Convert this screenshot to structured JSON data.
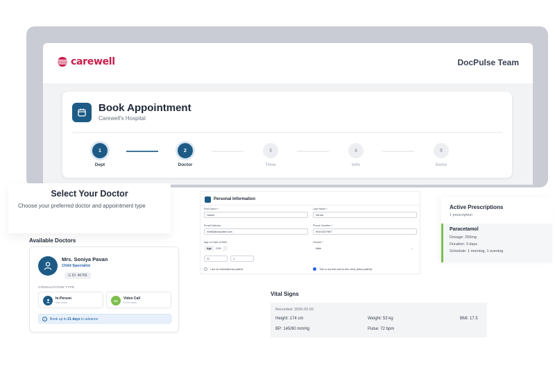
{
  "header": {
    "brand": "carewell",
    "team": "DocPulse Team"
  },
  "booking": {
    "title": "Book Appointment",
    "subtitle": "Carewell's Hospital",
    "steps": [
      {
        "num": "1",
        "label": "Dept",
        "state": "active"
      },
      {
        "num": "2",
        "label": "Doctor",
        "state": "active"
      },
      {
        "num": "3",
        "label": "Time",
        "state": "inactive"
      },
      {
        "num": "4",
        "label": "Info",
        "state": "inactive"
      },
      {
        "num": "5",
        "label": "Done",
        "state": "inactive"
      }
    ]
  },
  "select": {
    "title": "Select Your Doctor",
    "subtitle": "Choose your preferred doctor and appointment type"
  },
  "doctors": {
    "section_title": "Available Doctors",
    "name": "Mrs. Soniya Pavan",
    "specialty": "Child Specialist",
    "id": "ID: 46766",
    "consult_label": "CONSULTATION TYPE",
    "in_person": {
      "title": "In-Person",
      "sub": "Visit clinic"
    },
    "video": {
      "title": "Video Call",
      "sub": "From home",
      "badge": "OK"
    },
    "advance_pre": "Book up to ",
    "advance_days": "21 days",
    "advance_post": " in advance"
  },
  "personal": {
    "title": "Personal Information",
    "first_name_label": "First Name *",
    "first_name": "Harish",
    "last_name_label": "Last Name *",
    "last_name": "Verma",
    "email_label": "Email Address",
    "email": "rohit8@docpulse.com",
    "phone_label": "Phone Number *",
    "phone": "09101527967",
    "age_label": "Age or Date of Birth",
    "age_tab": "Age",
    "dob_tab": "DOB",
    "age_years": "11",
    "age_months": "1",
    "gender_label": "Gender *",
    "gender": "Male",
    "intl_label": "I am an international patient",
    "first_visit_label": "This is my first visit to this clinic (New patient)"
  },
  "prescriptions": {
    "title": "Active Prescriptions",
    "count": "1 prescription",
    "name": "Paracetamol",
    "dosage": "Dosage: 250mg",
    "duration": "Duration: 3 days",
    "schedule": "Schedule: 1 morning, 1 evening"
  },
  "vitals": {
    "title": "Vital Signs",
    "recorded": "Recorded: 2026-02-02",
    "height": "Height: 174 cm",
    "weight": "Weight: 53 kg",
    "bmi": "BMI: 17.5",
    "bp": "BP: 145/90 mmHg",
    "pulse": "Pulse: 72 bpm"
  },
  "colors": {
    "primary": "#1d5b86",
    "brand": "#c81e4a",
    "accent_green": "#7dbf4f",
    "info_blue": "#2563a8"
  }
}
